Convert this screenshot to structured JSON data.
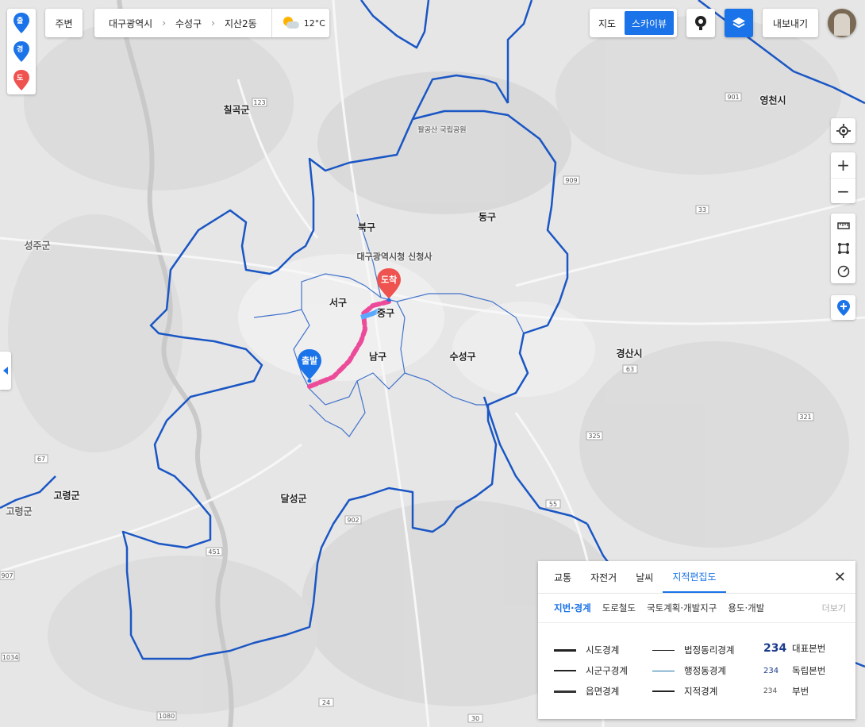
{
  "map": {
    "regions": [
      {
        "id": "chilgok",
        "label": "칠곡군"
      },
      {
        "id": "buk",
        "label": "북구"
      },
      {
        "id": "dong",
        "label": "동구"
      },
      {
        "id": "seo",
        "label": "서구"
      },
      {
        "id": "jung",
        "label": "중구"
      },
      {
        "id": "nam",
        "label": "남구"
      },
      {
        "id": "suseong",
        "label": "수성구"
      },
      {
        "id": "gyeongsan",
        "label": "경산시"
      },
      {
        "id": "yeongcheon",
        "label": "영천시"
      },
      {
        "id": "goryeong",
        "label": "고령군"
      },
      {
        "id": "dalseong",
        "label": "달성군"
      },
      {
        "id": "goryeong2",
        "label": "고령군"
      },
      {
        "id": "seongju",
        "label": "성주군"
      },
      {
        "id": "daegu_cityhall",
        "label": "대구광역시청 신청사"
      },
      {
        "id": "palgongsan",
        "label": "팔공산 국립공원"
      }
    ],
    "road_badges": [
      "123",
      "909",
      "901",
      "33",
      "63",
      "325",
      "321",
      "55",
      "902",
      "67",
      "451",
      "1034",
      "1080",
      "24",
      "30",
      "907"
    ],
    "markers": {
      "start": {
        "label": "출발",
        "color": "#1a73e8"
      },
      "arrive": {
        "label": "도착",
        "color": "#ef5350"
      }
    },
    "route_color": "#ec4b9a",
    "boundary_color": "#1a56c4"
  },
  "left_pins": [
    {
      "label": "출",
      "color": "#1a73e8"
    },
    {
      "label": "경",
      "color": "#1a73e8"
    },
    {
      "label": "도",
      "color": "#ef5350"
    }
  ],
  "toolbar": {
    "nearby": "주변",
    "breadcrumb": [
      "대구광역시",
      "수성구",
      "지산2동"
    ],
    "weather_temp": "12°C",
    "map_btn": "지도",
    "skyview_btn": "스카이뷰",
    "export_btn": "내보내기"
  },
  "panel": {
    "tabs": [
      "교통",
      "자전거",
      "날씨",
      "지적편집도"
    ],
    "active_tab": "지적편집도",
    "subtabs": [
      "지번·경계",
      "도로철도",
      "국토계획·개발지구",
      "용도·개발"
    ],
    "active_subtab": "지번·경계",
    "more": "더보기",
    "legend": {
      "col1": [
        "시도경계",
        "시군구경계",
        "읍면경계"
      ],
      "col2": [
        "법정동리경계",
        "행정동경계",
        "지적경계"
      ],
      "col3_nums": [
        "234",
        "234",
        "234"
      ],
      "col3_labels": [
        "대표본번",
        "독립본번",
        "부번"
      ]
    }
  },
  "colors": {
    "accent": "#1a73e8",
    "boundary": "#1a56c4",
    "route": "#ec4b9a",
    "arrive": "#ef5350"
  }
}
